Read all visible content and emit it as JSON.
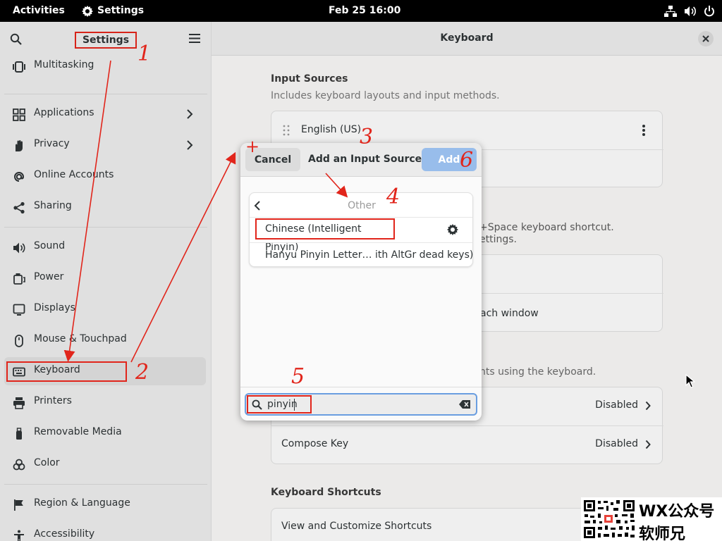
{
  "topbar": {
    "activities": "Activities",
    "app_name": "Settings",
    "clock": "Feb 25  16:00"
  },
  "sidebar": {
    "title": "Settings",
    "items": [
      {
        "label": "Multitasking",
        "icon": "multitasking-icon"
      },
      {
        "label": "Applications",
        "icon": "applications-icon"
      },
      {
        "label": "Privacy",
        "icon": "privacy-icon"
      },
      {
        "label": "Online Accounts",
        "icon": "online-accounts-icon"
      },
      {
        "label": "Sharing",
        "icon": "sharing-icon"
      },
      {
        "label": "Sound",
        "icon": "sound-icon"
      },
      {
        "label": "Power",
        "icon": "power-icon"
      },
      {
        "label": "Displays",
        "icon": "displays-icon"
      },
      {
        "label": "Mouse & Touchpad",
        "icon": "mouse-icon"
      },
      {
        "label": "Keyboard",
        "icon": "keyboard-icon",
        "selected": true
      },
      {
        "label": "Printers",
        "icon": "printer-icon"
      },
      {
        "label": "Removable Media",
        "icon": "usb-icon"
      },
      {
        "label": "Color",
        "icon": "color-icon"
      },
      {
        "label": "Region & Language",
        "icon": "flag-icon"
      },
      {
        "label": "Accessibility",
        "icon": "accessibility-icon"
      }
    ]
  },
  "main": {
    "title": "Keyboard",
    "input_sources": {
      "title": "Input Sources",
      "subtitle": "Includes keyboard layouts and input methods.",
      "items": [
        "English (US)"
      ]
    },
    "switching_fragment": {
      "line1": "+Space keyboard shortcut.",
      "line2": "ettings."
    },
    "per_window_fragment": "ach window",
    "special_fragment": "nts using the keyboard.",
    "alternate_chars": {
      "value": "Disabled"
    },
    "compose_key": {
      "label": "Compose Key",
      "value": "Disabled"
    },
    "shortcuts": {
      "title": "Keyboard Shortcuts",
      "row": "View and Customize Shortcuts"
    }
  },
  "dialog": {
    "cancel": "Cancel",
    "title": "Add an Input Source",
    "add": "Add",
    "category": "Other",
    "options": [
      "Chinese (Intelligent Pinyin)",
      "Hanyu Pinyin Letter…  ith AltGr dead keys)"
    ],
    "search_value": "pinyin"
  },
  "annotations": {
    "plus": "+",
    "steps": [
      "1",
      "2",
      "3",
      "4",
      "5",
      "6"
    ],
    "color": "#e1251b"
  },
  "watermark": {
    "line1": "WX公众号",
    "line2": "软师兄"
  },
  "colors": {
    "accent": "#98bdeb",
    "focus": "#6a9ee0",
    "annotation": "#e1251b"
  }
}
